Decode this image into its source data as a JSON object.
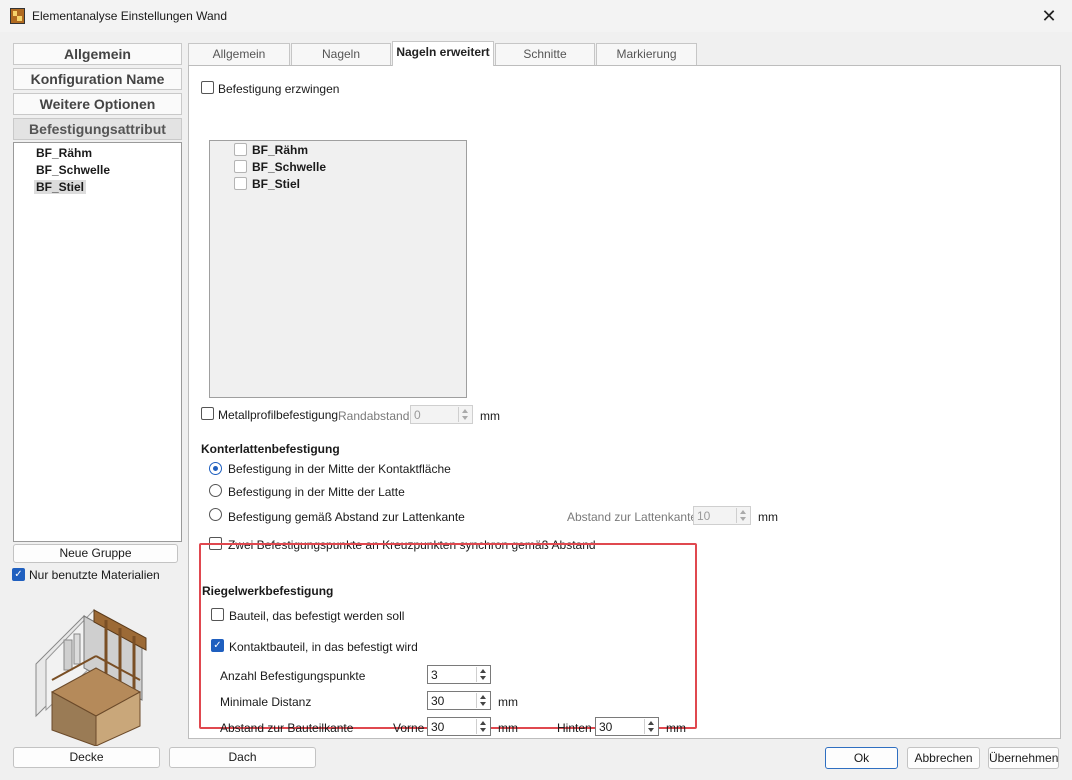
{
  "window": {
    "title": "Elementanalyse Einstellungen Wand"
  },
  "left_tabs": [
    "Allgemein",
    "Konfiguration Name",
    "Weitere Optionen",
    "Befestigungsattribut"
  ],
  "left_list": [
    "BF_Rähm",
    "BF_Schwelle",
    "BF_Stiel"
  ],
  "new_group_label": "Neue Gruppe",
  "only_used_label": "Nur benutzte Materialien",
  "tabs": [
    "Allgemein",
    "Nageln",
    "Nageln erweitert",
    "Schnitte",
    "Markierung"
  ],
  "force": {
    "label": "Befestigung erzwingen",
    "items": [
      "BF_Rähm",
      "BF_Schwelle",
      "BF_Stiel"
    ]
  },
  "metal": {
    "label": "Metallprofilbefestigung",
    "edge_label": "Randabstand",
    "value": "0",
    "unit": "mm"
  },
  "counter": {
    "heading": "Konterlattenbefestigung",
    "opt1": "Befestigung in der Mitte der Kontaktfläche",
    "opt2": "Befestigung in der Mitte der Latte",
    "opt3": "Befestigung gemäß Abstand zur Lattenkante",
    "distance_label": "Abstand zur Lattenkante",
    "distance_value": "10",
    "unit": "mm",
    "sync_label": "Zwei Befestigungspunkte an Kreuzpunkten synchron gemäß Abstand"
  },
  "riegel": {
    "heading": "Riegelwerkbefestigung",
    "part_label": "Bauteil, das befestigt werden soll",
    "contact_label": "Kontaktbauteil, in das befestigt wird",
    "count_label": "Anzahl Befestigungspunkte",
    "count_value": "3",
    "min_label": "Minimale Distanz",
    "min_value": "30",
    "edge_label": "Abstand zur Bauteilkante",
    "front_label": "Vorne",
    "front_value": "30",
    "back_label": "Hinten",
    "back_value": "30",
    "unit": "mm"
  },
  "bottom_buttons": {
    "decke": "Decke",
    "dach": "Dach",
    "ok": "Ok",
    "cancel": "Abbrechen",
    "apply": "Übernehmen"
  },
  "colors": {
    "accent": "#1f5fbf",
    "highlight": "#e0484f"
  }
}
